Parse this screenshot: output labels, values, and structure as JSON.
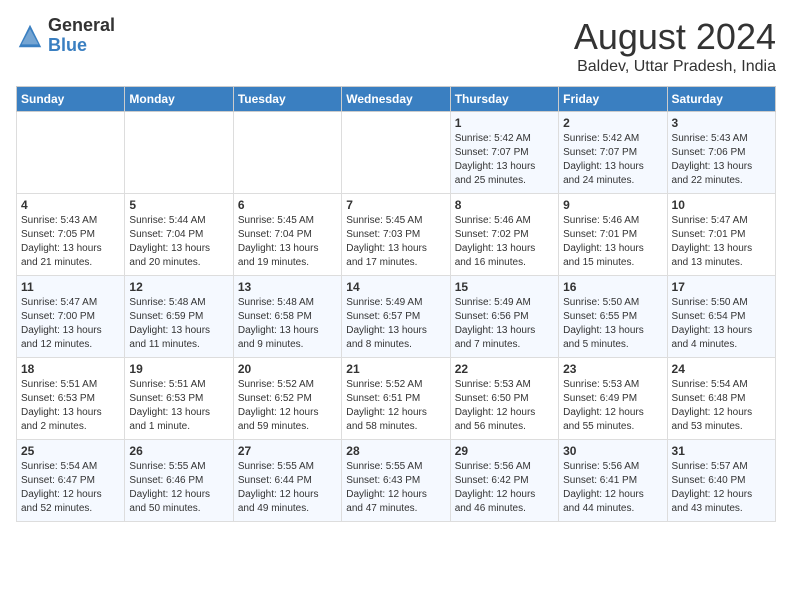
{
  "logo": {
    "general": "General",
    "blue": "Blue"
  },
  "title": {
    "month_year": "August 2024",
    "location": "Baldev, Uttar Pradesh, India"
  },
  "days_header": [
    "Sunday",
    "Monday",
    "Tuesday",
    "Wednesday",
    "Thursday",
    "Friday",
    "Saturday"
  ],
  "weeks": [
    [
      {
        "day": "",
        "info": ""
      },
      {
        "day": "",
        "info": ""
      },
      {
        "day": "",
        "info": ""
      },
      {
        "day": "",
        "info": ""
      },
      {
        "day": "1",
        "info": "Sunrise: 5:42 AM\nSunset: 7:07 PM\nDaylight: 13 hours\nand 25 minutes."
      },
      {
        "day": "2",
        "info": "Sunrise: 5:42 AM\nSunset: 7:07 PM\nDaylight: 13 hours\nand 24 minutes."
      },
      {
        "day": "3",
        "info": "Sunrise: 5:43 AM\nSunset: 7:06 PM\nDaylight: 13 hours\nand 22 minutes."
      }
    ],
    [
      {
        "day": "4",
        "info": "Sunrise: 5:43 AM\nSunset: 7:05 PM\nDaylight: 13 hours\nand 21 minutes."
      },
      {
        "day": "5",
        "info": "Sunrise: 5:44 AM\nSunset: 7:04 PM\nDaylight: 13 hours\nand 20 minutes."
      },
      {
        "day": "6",
        "info": "Sunrise: 5:45 AM\nSunset: 7:04 PM\nDaylight: 13 hours\nand 19 minutes."
      },
      {
        "day": "7",
        "info": "Sunrise: 5:45 AM\nSunset: 7:03 PM\nDaylight: 13 hours\nand 17 minutes."
      },
      {
        "day": "8",
        "info": "Sunrise: 5:46 AM\nSunset: 7:02 PM\nDaylight: 13 hours\nand 16 minutes."
      },
      {
        "day": "9",
        "info": "Sunrise: 5:46 AM\nSunset: 7:01 PM\nDaylight: 13 hours\nand 15 minutes."
      },
      {
        "day": "10",
        "info": "Sunrise: 5:47 AM\nSunset: 7:01 PM\nDaylight: 13 hours\nand 13 minutes."
      }
    ],
    [
      {
        "day": "11",
        "info": "Sunrise: 5:47 AM\nSunset: 7:00 PM\nDaylight: 13 hours\nand 12 minutes."
      },
      {
        "day": "12",
        "info": "Sunrise: 5:48 AM\nSunset: 6:59 PM\nDaylight: 13 hours\nand 11 minutes."
      },
      {
        "day": "13",
        "info": "Sunrise: 5:48 AM\nSunset: 6:58 PM\nDaylight: 13 hours\nand 9 minutes."
      },
      {
        "day": "14",
        "info": "Sunrise: 5:49 AM\nSunset: 6:57 PM\nDaylight: 13 hours\nand 8 minutes."
      },
      {
        "day": "15",
        "info": "Sunrise: 5:49 AM\nSunset: 6:56 PM\nDaylight: 13 hours\nand 7 minutes."
      },
      {
        "day": "16",
        "info": "Sunrise: 5:50 AM\nSunset: 6:55 PM\nDaylight: 13 hours\nand 5 minutes."
      },
      {
        "day": "17",
        "info": "Sunrise: 5:50 AM\nSunset: 6:54 PM\nDaylight: 13 hours\nand 4 minutes."
      }
    ],
    [
      {
        "day": "18",
        "info": "Sunrise: 5:51 AM\nSunset: 6:53 PM\nDaylight: 13 hours\nand 2 minutes."
      },
      {
        "day": "19",
        "info": "Sunrise: 5:51 AM\nSunset: 6:53 PM\nDaylight: 13 hours\nand 1 minute."
      },
      {
        "day": "20",
        "info": "Sunrise: 5:52 AM\nSunset: 6:52 PM\nDaylight: 12 hours\nand 59 minutes."
      },
      {
        "day": "21",
        "info": "Sunrise: 5:52 AM\nSunset: 6:51 PM\nDaylight: 12 hours\nand 58 minutes."
      },
      {
        "day": "22",
        "info": "Sunrise: 5:53 AM\nSunset: 6:50 PM\nDaylight: 12 hours\nand 56 minutes."
      },
      {
        "day": "23",
        "info": "Sunrise: 5:53 AM\nSunset: 6:49 PM\nDaylight: 12 hours\nand 55 minutes."
      },
      {
        "day": "24",
        "info": "Sunrise: 5:54 AM\nSunset: 6:48 PM\nDaylight: 12 hours\nand 53 minutes."
      }
    ],
    [
      {
        "day": "25",
        "info": "Sunrise: 5:54 AM\nSunset: 6:47 PM\nDaylight: 12 hours\nand 52 minutes."
      },
      {
        "day": "26",
        "info": "Sunrise: 5:55 AM\nSunset: 6:46 PM\nDaylight: 12 hours\nand 50 minutes."
      },
      {
        "day": "27",
        "info": "Sunrise: 5:55 AM\nSunset: 6:44 PM\nDaylight: 12 hours\nand 49 minutes."
      },
      {
        "day": "28",
        "info": "Sunrise: 5:55 AM\nSunset: 6:43 PM\nDaylight: 12 hours\nand 47 minutes."
      },
      {
        "day": "29",
        "info": "Sunrise: 5:56 AM\nSunset: 6:42 PM\nDaylight: 12 hours\nand 46 minutes."
      },
      {
        "day": "30",
        "info": "Sunrise: 5:56 AM\nSunset: 6:41 PM\nDaylight: 12 hours\nand 44 minutes."
      },
      {
        "day": "31",
        "info": "Sunrise: 5:57 AM\nSunset: 6:40 PM\nDaylight: 12 hours\nand 43 minutes."
      }
    ]
  ]
}
